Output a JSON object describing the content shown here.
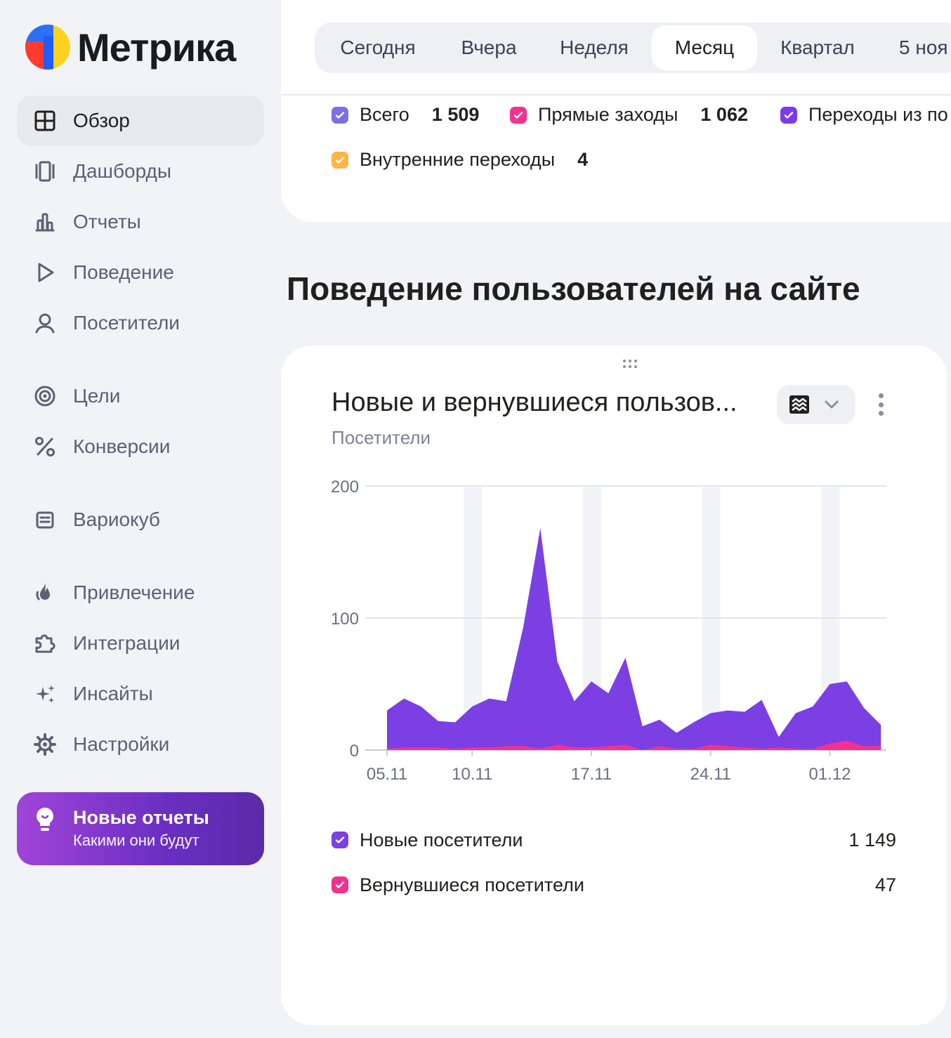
{
  "brand": {
    "name": "Метрика"
  },
  "sidebar": {
    "items": [
      {
        "label": "Обзор",
        "icon": "grid-icon",
        "active": true
      },
      {
        "label": "Дашборды",
        "icon": "dashboards-icon"
      },
      {
        "label": "Отчеты",
        "icon": "bar-chart-icon"
      },
      {
        "label": "Поведение",
        "icon": "play-icon"
      },
      {
        "label": "Посетители",
        "icon": "user-icon"
      },
      {
        "label": "Цели",
        "icon": "target-icon"
      },
      {
        "label": "Конверсии",
        "icon": "percent-icon"
      },
      {
        "label": "Вариокуб",
        "icon": "variocube-icon"
      },
      {
        "label": "Привлечение",
        "icon": "flame-icon"
      },
      {
        "label": "Интеграции",
        "icon": "puzzle-icon"
      },
      {
        "label": "Инсайты",
        "icon": "sparkles-icon"
      },
      {
        "label": "Настройки",
        "icon": "gear-icon"
      }
    ],
    "promo": {
      "title": "Новые отчеты",
      "subtitle": "Какими они будут",
      "icon": "lightbulb-icon"
    }
  },
  "periods": {
    "tabs": [
      "Сегодня",
      "Вчера",
      "Неделя",
      "Месяц",
      "Квартал",
      "5 ноя"
    ],
    "active": "Месяц"
  },
  "sources": {
    "items": [
      {
        "name": "Всего",
        "value": "1 509",
        "color": "#7b6fe6"
      },
      {
        "name": "Прямые заходы",
        "value": "1 062",
        "color": "#f5308f"
      },
      {
        "name": "Переходы из по",
        "value": "",
        "color": "#7c3aed"
      },
      {
        "name": "Внутренние переходы",
        "value": "4",
        "color": "#ffb443"
      }
    ]
  },
  "section": {
    "title": "Поведение пользователей на сайте"
  },
  "widget": {
    "title": "Новые и вернувшиеся пользов...",
    "subtitle": "Посетители",
    "chart_type_icon": "stacked-area-icon",
    "menu_icon": "more-vertical-icon",
    "drag_icon": "drag-dots-icon",
    "legend": [
      {
        "name": "Новые посетители",
        "total": "1 149",
        "color": "#7b3fe4"
      },
      {
        "name": "Вернувшиеся посетители",
        "total": "47",
        "color": "#f5308f"
      }
    ]
  },
  "chart_data": {
    "type": "area",
    "stacked": true,
    "x": [
      "05.11",
      "06.11",
      "07.11",
      "08.11",
      "09.11",
      "10.11",
      "11.11",
      "12.11",
      "13.11",
      "14.11",
      "15.11",
      "16.11",
      "17.11",
      "18.11",
      "19.11",
      "20.11",
      "21.11",
      "22.11",
      "23.11",
      "24.11",
      "25.11",
      "26.11",
      "27.11",
      "28.11",
      "29.11",
      "30.11",
      "01.12",
      "02.12",
      "03.12",
      "04.12"
    ],
    "x_ticks": [
      "05.11",
      "10.11",
      "17.11",
      "24.11",
      "01.12"
    ],
    "ylim": [
      0,
      200
    ],
    "y_ticks": [
      0,
      100,
      200
    ],
    "weekend_bands": [
      [
        "09.11",
        "10.11"
      ],
      [
        "16.11",
        "17.11"
      ],
      [
        "23.11",
        "24.11"
      ],
      [
        "30.11",
        "01.12"
      ]
    ],
    "series": [
      {
        "name": "Новые посетители",
        "values": [
          29,
          37,
          31,
          20,
          20,
          31,
          37,
          34,
          90,
          167,
          63,
          35,
          50,
          40,
          66,
          18,
          20,
          12,
          20,
          24,
          27,
          27,
          37,
          8,
          27,
          32,
          45,
          45,
          29,
          16
        ]
      },
      {
        "name": "Вернувшиеся посетители",
        "values": [
          1,
          2,
          2,
          2,
          1,
          2,
          2,
          3,
          3,
          1,
          4,
          2,
          2,
          3,
          4,
          0,
          3,
          1,
          1,
          4,
          3,
          2,
          1,
          2,
          1,
          1,
          5,
          7,
          3,
          3
        ]
      }
    ],
    "grid": true
  }
}
